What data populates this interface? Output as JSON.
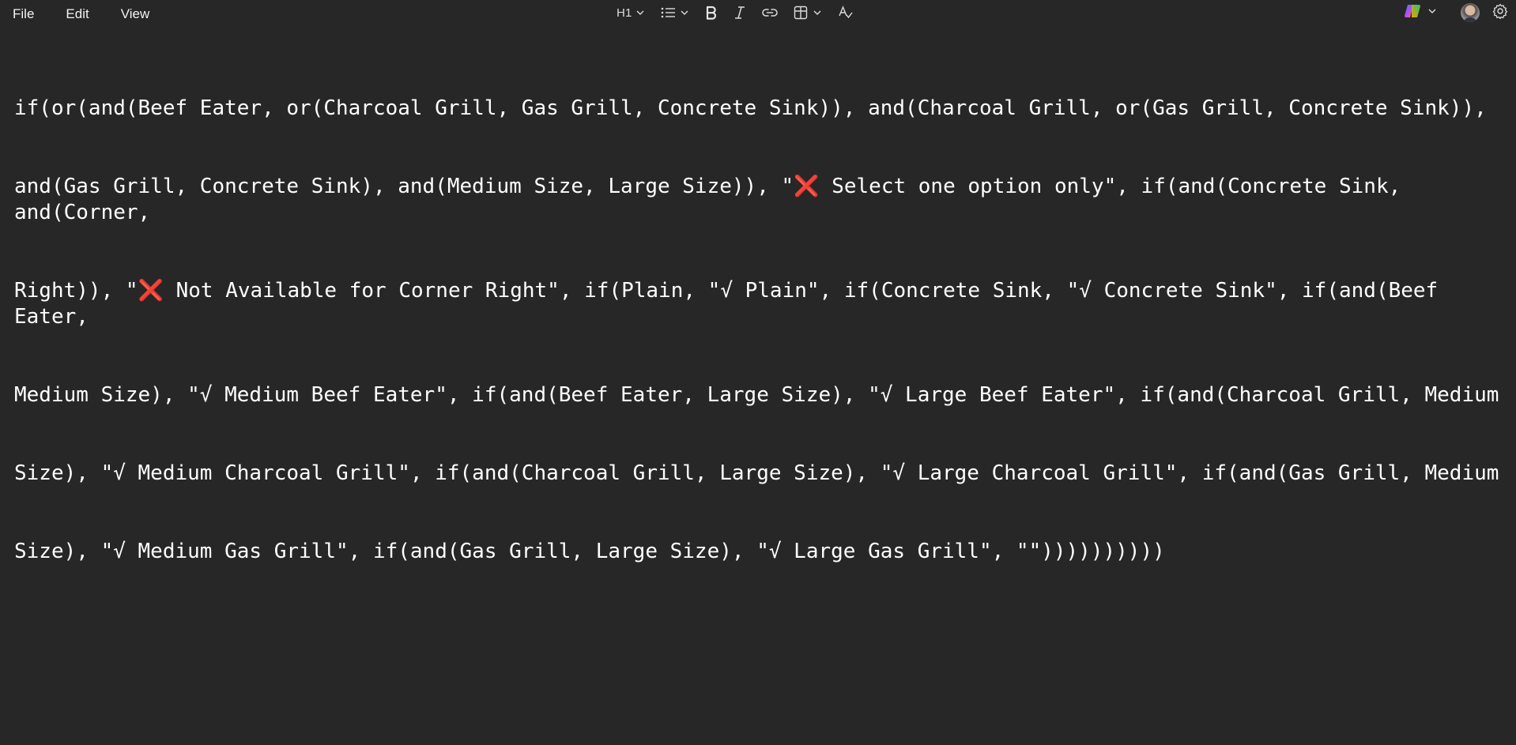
{
  "menu": {
    "file_label": "File",
    "edit_label": "Edit",
    "view_label": "View"
  },
  "format": {
    "heading_label": "H1",
    "icons": [
      "list-icon",
      "bold-icon",
      "italic-icon",
      "link-icon",
      "table-icon",
      "spellcheck-icon"
    ]
  },
  "header_right": {
    "icons": [
      "copilot-icon",
      "avatar",
      "settings-icon"
    ]
  },
  "editor": {
    "lines": [
      "if(or(and(Beef Eater, or(Charcoal Grill, Gas Grill, Concrete Sink)), and(Charcoal Grill, or(Gas Grill, Concrete Sink)),",
      "and(Gas Grill, Concrete Sink), and(Medium Size, Large Size)), \"❌ Select one option only\", if(and(Concrete Sink, and(Corner,",
      "Right)), \"❌ Not Available for Corner Right\", if(Plain, \"√ Plain\", if(Concrete Sink, \"√ Concrete Sink\", if(and(Beef Eater,",
      "Medium Size), \"√ Medium Beef Eater\", if(and(Beef Eater, Large Size), \"√ Large Beef Eater\", if(and(Charcoal Grill, Medium",
      "Size), \"√ Medium Charcoal Grill\", if(and(Charcoal Grill, Large Size), \"√ Large Charcoal Grill\", if(and(Gas Grill, Medium",
      "Size), \"√ Medium Gas Grill\", if(and(Gas Grill, Large Size), \"√ Large Gas Grill\", \"\"))))))))))"
    ]
  },
  "colors": {
    "background": "#272727",
    "text": "#ffffff",
    "error_mark": "#f24a62"
  }
}
